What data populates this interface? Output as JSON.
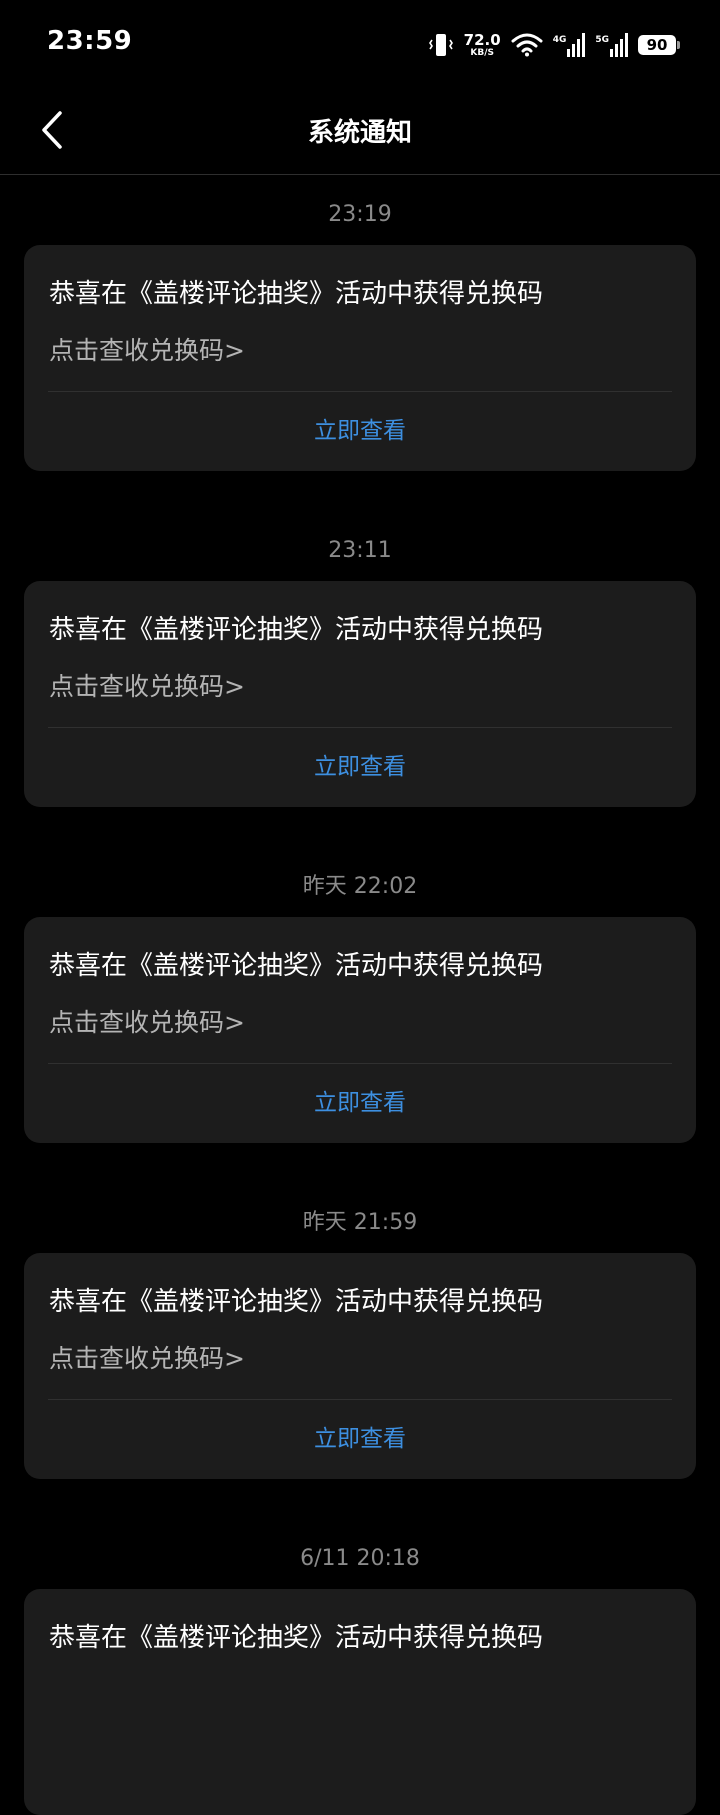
{
  "status_bar": {
    "time": "23:59",
    "net_speed_value": "72.0",
    "net_speed_unit": "KB/S",
    "signal_1_label": "4G",
    "signal_2_label": "5G",
    "battery": "90",
    "icons": [
      "vibrate-icon",
      "wifi-icon",
      "signal-icon",
      "signal-icon",
      "battery-icon"
    ]
  },
  "header": {
    "title": "系统通知",
    "back_icon": "chevron-left-icon"
  },
  "colors": {
    "background": "#000000",
    "card": "#1c1c1c",
    "accent": "#3d8fe0",
    "time_text": "#8a8a8a",
    "secondary_text": "#b4b4b4"
  },
  "notices": [
    {
      "time": "23:19",
      "title": "恭喜在《盖楼评论抽奖》活动中获得兑换码",
      "link": "点击查收兑换码>",
      "action": "立即查看"
    },
    {
      "time": "23:11",
      "title": "恭喜在《盖楼评论抽奖》活动中获得兑换码",
      "link": "点击查收兑换码>",
      "action": "立即查看"
    },
    {
      "time": "昨天  22:02",
      "title": "恭喜在《盖楼评论抽奖》活动中获得兑换码",
      "link": "点击查收兑换码>",
      "action": "立即查看"
    },
    {
      "time": "昨天  21:59",
      "title": "恭喜在《盖楼评论抽奖》活动中获得兑换码",
      "link": "点击查收兑换码>",
      "action": "立即查看"
    },
    {
      "time": "6/11  20:18",
      "title": "恭喜在《盖楼评论抽奖》活动中获得兑换码",
      "link": "",
      "action": ""
    }
  ]
}
